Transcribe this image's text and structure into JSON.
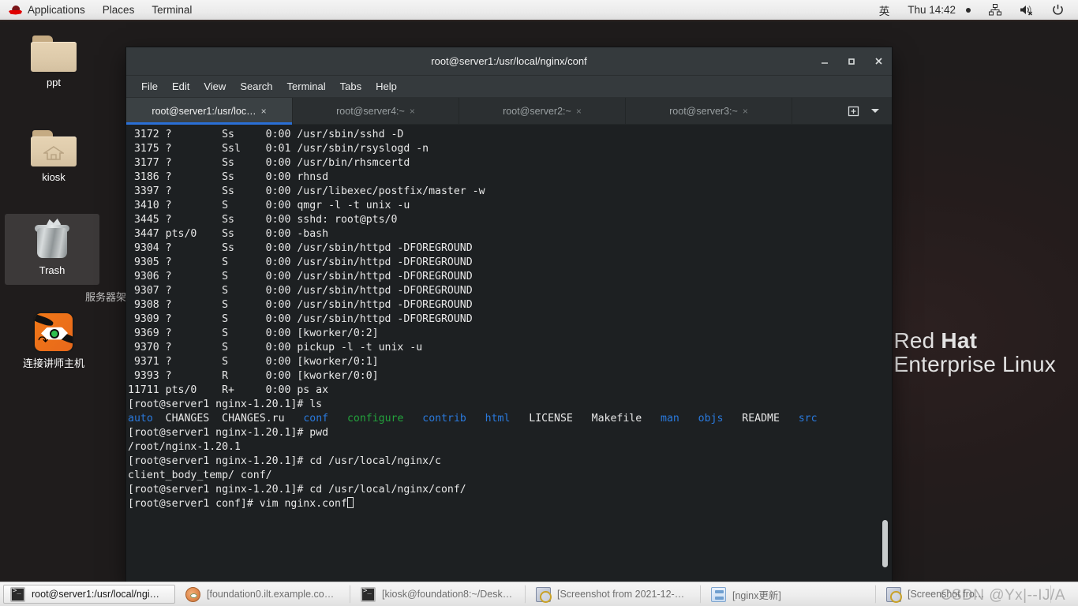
{
  "top_panel": {
    "logo_icon": "redhat-fedora-icon",
    "menus": [
      "Applications",
      "Places",
      "Terminal"
    ],
    "input_method": "英",
    "clock": "Thu 14:42",
    "tray": [
      "network-icon",
      "volume-muted-icon",
      "power-icon"
    ]
  },
  "desktop": {
    "icons": [
      {
        "label": "ppt",
        "icon": "folder-icon",
        "selected": false
      },
      {
        "label": "kiosk",
        "icon": "folder-home-icon",
        "selected": false
      },
      {
        "label": "Trash",
        "icon": "trash-icon",
        "selected": true
      },
      {
        "label": "连接讲师主机",
        "icon": "tigervnc-shortcut-icon",
        "selected": false
      }
    ],
    "occluded_icon_label": "服务器架构演变…",
    "brand": {
      "line1_regular": "Red ",
      "line1_bold": "Hat",
      "line2": "Enterprise Linux"
    }
  },
  "terminal": {
    "title": "root@server1:/usr/local/nginx/conf",
    "window_buttons": [
      "minimize",
      "maximize",
      "close"
    ],
    "menus": [
      "File",
      "Edit",
      "View",
      "Search",
      "Terminal",
      "Tabs",
      "Help"
    ],
    "tabs": [
      {
        "label": "root@server1:/usr/loc…",
        "active": true,
        "close": "×"
      },
      {
        "label": "root@server4:~",
        "active": false,
        "close": "×"
      },
      {
        "label": "root@server2:~",
        "active": false,
        "close": "×"
      },
      {
        "label": "root@server3:~",
        "active": false,
        "close": "×"
      }
    ],
    "tab_tools": [
      "new-tab-icon",
      "tab-list-dropdown-icon"
    ],
    "lines": [
      " 3172 ?        Ss     0:00 /usr/sbin/sshd -D",
      " 3175 ?        Ssl    0:01 /usr/sbin/rsyslogd -n",
      " 3177 ?        Ss     0:00 /usr/bin/rhsmcertd",
      " 3186 ?        Ss     0:00 rhnsd",
      " 3397 ?        Ss     0:00 /usr/libexec/postfix/master -w",
      " 3410 ?        S      0:00 qmgr -l -t unix -u",
      " 3445 ?        Ss     0:00 sshd: root@pts/0",
      " 3447 pts/0    Ss     0:00 -bash",
      " 9304 ?        Ss     0:00 /usr/sbin/httpd -DFOREGROUND",
      " 9305 ?        S      0:00 /usr/sbin/httpd -DFOREGROUND",
      " 9306 ?        S      0:00 /usr/sbin/httpd -DFOREGROUND",
      " 9307 ?        S      0:00 /usr/sbin/httpd -DFOREGROUND",
      " 9308 ?        S      0:00 /usr/sbin/httpd -DFOREGROUND",
      " 9309 ?        S      0:00 /usr/sbin/httpd -DFOREGROUND",
      " 9369 ?        S      0:00 [kworker/0:2]",
      " 9370 ?        S      0:00 pickup -l -t unix -u",
      " 9371 ?        S      0:00 [kworker/0:1]",
      " 9393 ?        R      0:00 [kworker/0:0]",
      "11711 pts/0    R+     0:00 ps ax",
      "[root@server1 nginx-1.20.1]# ls"
    ],
    "ls_output": [
      {
        "name": "auto",
        "kind": "dir"
      },
      {
        "name": "CHANGES",
        "kind": "file"
      },
      {
        "name": "CHANGES.ru",
        "kind": "file"
      },
      {
        "name": "conf",
        "kind": "dir"
      },
      {
        "name": "configure",
        "kind": "exec"
      },
      {
        "name": "contrib",
        "kind": "dir"
      },
      {
        "name": "html",
        "kind": "dir"
      },
      {
        "name": "LICENSE",
        "kind": "file"
      },
      {
        "name": "Makefile",
        "kind": "file"
      },
      {
        "name": "man",
        "kind": "dir"
      },
      {
        "name": "objs",
        "kind": "dir"
      },
      {
        "name": "README",
        "kind": "file"
      },
      {
        "name": "src",
        "kind": "dir"
      }
    ],
    "tail_lines": [
      "[root@server1 nginx-1.20.1]# pwd",
      "/root/nginx-1.20.1",
      "[root@server1 nginx-1.20.1]# cd /usr/local/nginx/c",
      "client_body_temp/ conf/",
      "[root@server1 nginx-1.20.1]# cd /usr/local/nginx/conf/"
    ],
    "prompt": "[root@server1 conf]# vim nginx.conf",
    "colors": {
      "dir": "#2a7ade",
      "exec": "#23a33c",
      "file": "#e8e8e8",
      "bg": "#1d2022"
    }
  },
  "taskbar": {
    "items": [
      {
        "label": "root@server1:/usr/local/ngi…",
        "icon": "terminal-icon",
        "active": true
      },
      {
        "label": "[foundation0.ilt.example.co…",
        "icon": "vnc-icon",
        "active": false
      },
      {
        "label": "[kiosk@foundation8:~/Desk…",
        "icon": "terminal-icon",
        "active": false
      },
      {
        "label": "[Screenshot from 2021-12-…",
        "icon": "screenshot-icon",
        "active": false
      },
      {
        "label": "[nginx更新]",
        "icon": "document-icon",
        "active": false
      },
      {
        "label": "[Screenshot fro…",
        "icon": "screenshot-icon",
        "active": false
      }
    ]
  },
  "watermark": "CSDN @Yx|--IJ/A"
}
